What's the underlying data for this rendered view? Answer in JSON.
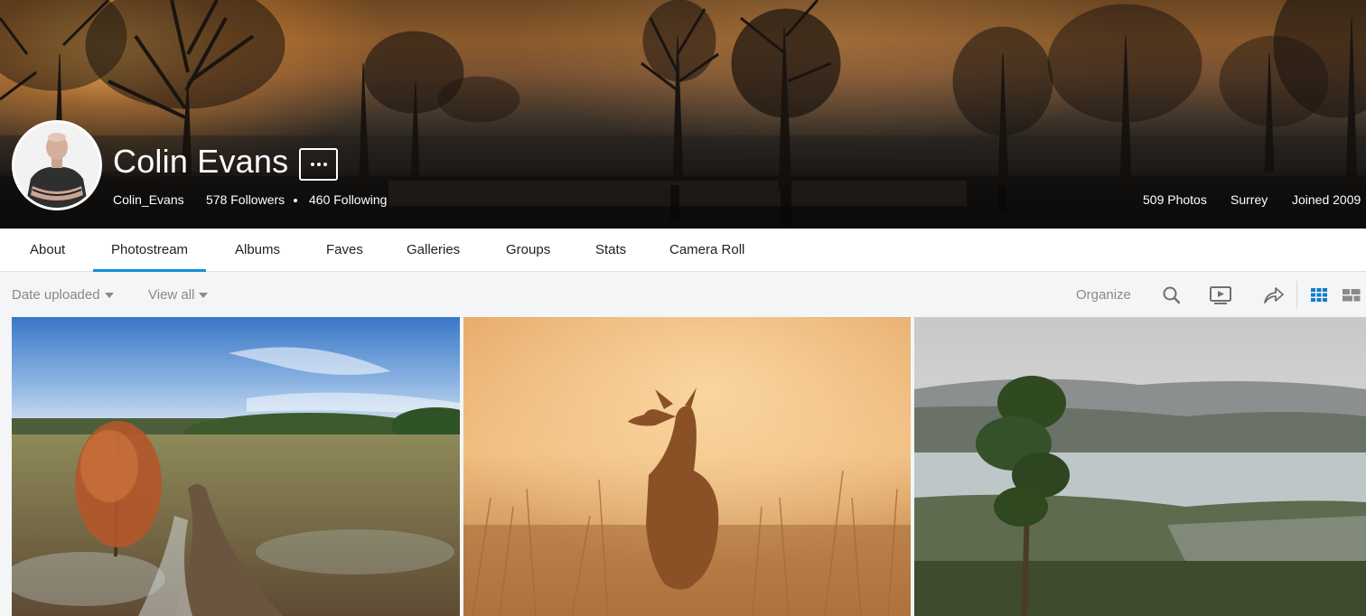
{
  "profile": {
    "display_name": "Colin Evans",
    "username": "Colin_Evans",
    "followers": "578 Followers",
    "following": "460 Following",
    "photos_count": "509 Photos",
    "location": "Surrey",
    "joined": "Joined 2009"
  },
  "tabs": [
    {
      "label": "About"
    },
    {
      "label": "Photostream",
      "active": true
    },
    {
      "label": "Albums"
    },
    {
      "label": "Faves"
    },
    {
      "label": "Galleries"
    },
    {
      "label": "Groups"
    },
    {
      "label": "Stats"
    },
    {
      "label": "Camera Roll"
    }
  ],
  "toolbar": {
    "sort_label": "Date uploaded",
    "filter_label": "View all",
    "organize_label": "Organize",
    "icons": [
      "search-icon",
      "slideshow-icon",
      "share-icon",
      "grid-view-icon",
      "justified-view-icon"
    ]
  },
  "colors": {
    "accent": "#128fdc",
    "muted_text": "#898989",
    "active_view_icon": "#0f7ec4"
  },
  "photos": [
    {
      "subject": "heathland-path-with-autumn-tree"
    },
    {
      "subject": "deer-silhouette-golden-mist"
    },
    {
      "subject": "pine-tree-over-misty-valley"
    }
  ]
}
